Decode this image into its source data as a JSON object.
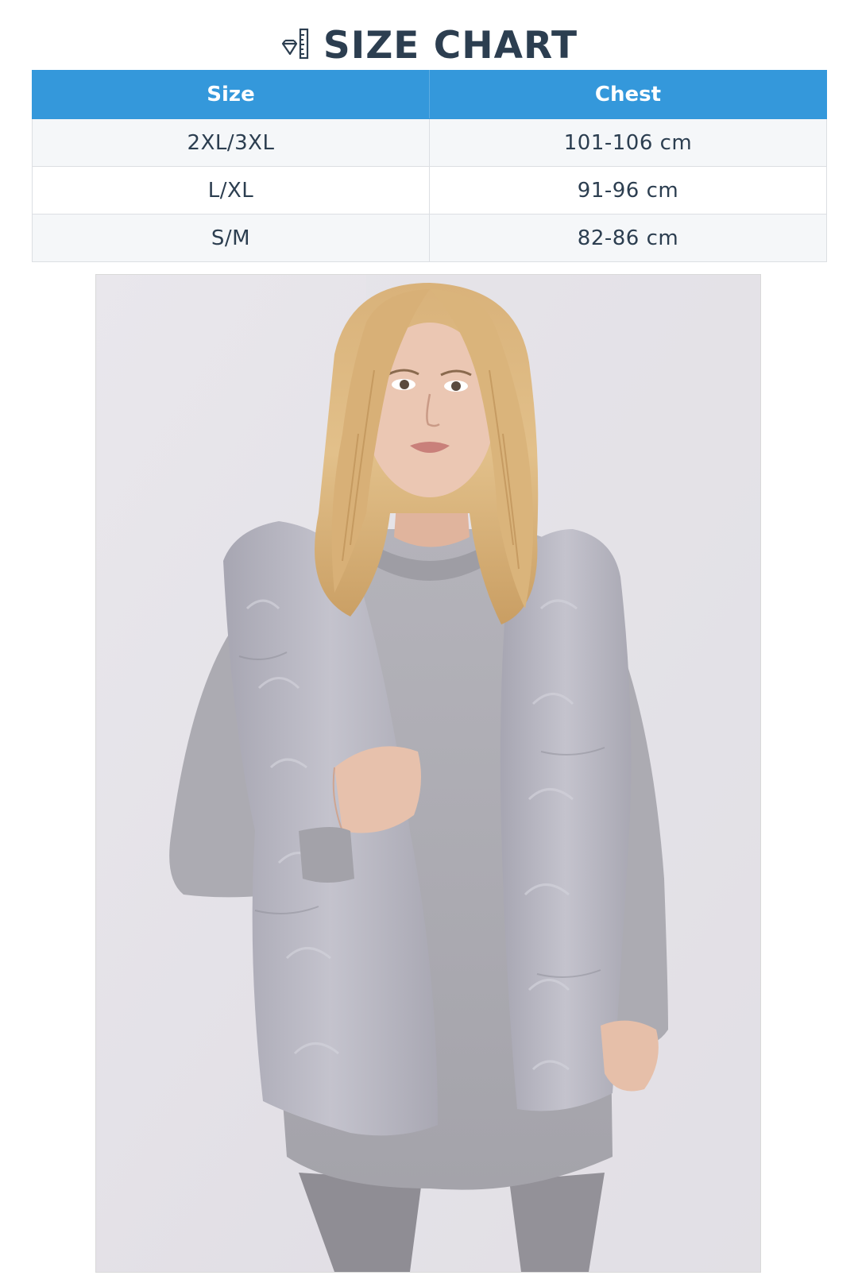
{
  "header": {
    "title": "SIZE CHART",
    "icon": "ruler-diamond-icon"
  },
  "table": {
    "columns": [
      "Size",
      "Chest"
    ],
    "rows": [
      {
        "size": "2XL/3XL",
        "chest": "101-106 cm"
      },
      {
        "size": "L/XL",
        "chest": "91-96 cm"
      },
      {
        "size": "S/M",
        "chest": "82-86 cm"
      }
    ]
  },
  "photo": {
    "subject": "product-photo-model-grey-fur-vest"
  },
  "colors": {
    "header_bg": "#3498db",
    "title_text": "#2c3e50",
    "row_alt_bg": "#f5f7f9",
    "border": "#dcdfe3"
  }
}
